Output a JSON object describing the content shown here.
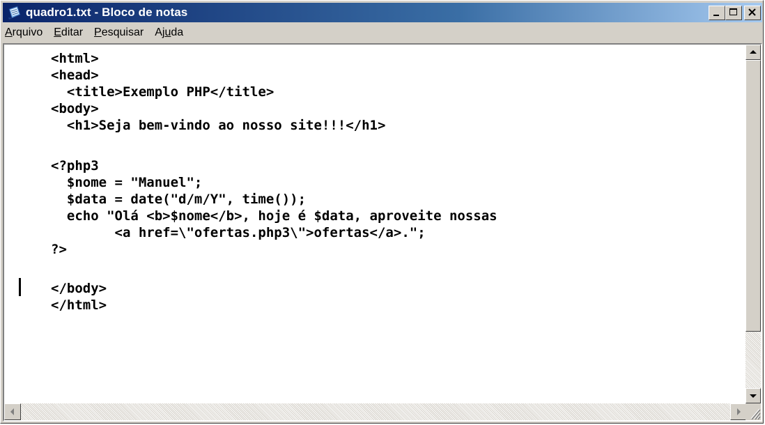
{
  "window": {
    "title": "quadro1.txt - Bloco de notas"
  },
  "menu": [
    {
      "accel": "A",
      "rest": "rquivo"
    },
    {
      "accel": "E",
      "rest": "ditar"
    },
    {
      "accel": "P",
      "rest": "esquisar"
    },
    {
      "pre": "Aj",
      "accel": "u",
      "rest": "da"
    }
  ],
  "editor": {
    "lines": [
      "<html>",
      "<head>",
      "  <title>Exemplo PHP</title>",
      "<body>",
      "  <h1>Seja bem-vindo ao nosso site!!!</h1>",
      "",
      "<?php3",
      "  $nome = \"Manuel\";",
      "  $data = date(\"d/m/Y\", time());",
      "  echo \"Olá <b>$nome</b>, hoje é $data, aproveite nossas",
      "        <a href=\\\"ofertas.php3\\\">ofertas</a>.\";",
      "?>",
      "",
      "</body>",
      "</html>"
    ]
  },
  "icons": {
    "app": "notepad-icon",
    "minimize": "minimize-icon",
    "maximize": "maximize-icon",
    "close": "close-icon",
    "scroll_up": "arrow-up-icon",
    "scroll_down": "arrow-down-icon",
    "scroll_left": "arrow-left-icon",
    "scroll_right": "arrow-right-icon",
    "grip": "size-grip-icon"
  },
  "colors": {
    "title_start": "#0a246a",
    "title_end": "#a6caf0",
    "face": "#d4d0c8"
  }
}
